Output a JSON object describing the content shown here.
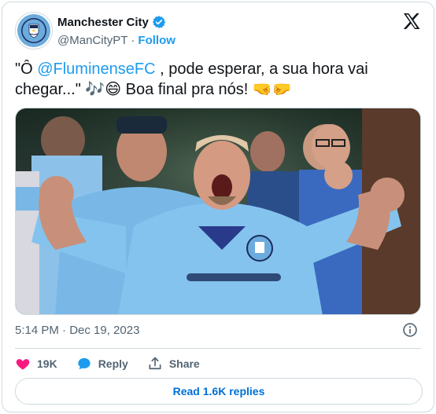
{
  "author": {
    "display_name": "Manchester City",
    "handle": "@ManCityPT",
    "follow_label": "Follow",
    "separator": "·"
  },
  "tweet": {
    "text_before": "\"Ô ",
    "mention": "@FluminenseFC",
    "text_after": " , pode esperar, a sua hora vai chegar...\" 🎶😄 Boa final pra nós! 🤜🤛"
  },
  "meta": {
    "timestamp": "5:14 PM · Dec 19, 2023"
  },
  "actions": {
    "likes_count": "19K",
    "reply_label": "Reply",
    "share_label": "Share"
  },
  "replies_button_label": "Read 1.6K replies",
  "colors": {
    "link": "#1d9bf0",
    "like": "#f91880",
    "reply": "#1d9bf0",
    "city_blue": "#6cabdd"
  }
}
